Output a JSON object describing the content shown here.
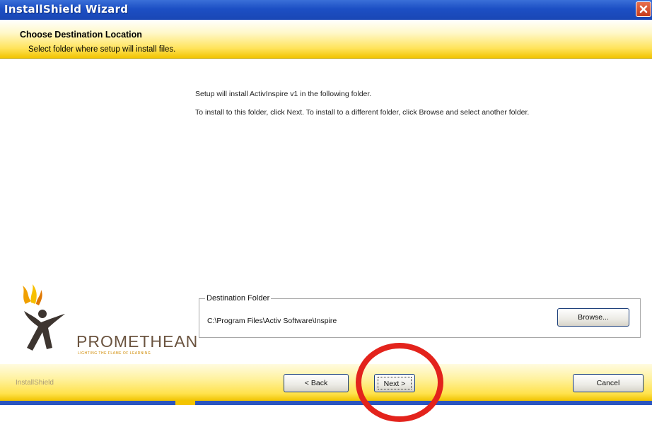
{
  "window": {
    "title": "InstallShield Wizard",
    "close_icon": "close-icon"
  },
  "banner": {
    "heading": "Choose Destination Location",
    "subheading": "Select folder where setup will install files."
  },
  "main": {
    "line1": "Setup will install ActivInspire v1 in the following folder.",
    "line2": "To install to this folder, click Next.  To install to a different folder, click Browse and select another folder."
  },
  "logo": {
    "brand": "PROMETHEAN",
    "tagline": "LIGHTING THE FLAME OF LEARNING"
  },
  "destination": {
    "legend": "Destination Folder",
    "path": "C:\\Program Files\\Activ Software\\Inspire",
    "browse_label": "Browse..."
  },
  "footer": {
    "brand": "InstallShield",
    "back_label": "< Back",
    "next_label": "Next >",
    "cancel_label": "Cancel"
  },
  "colors": {
    "titlebar": "#1c4fc4",
    "banner": "#ffe35a",
    "highlight_circle": "#e3231c"
  }
}
